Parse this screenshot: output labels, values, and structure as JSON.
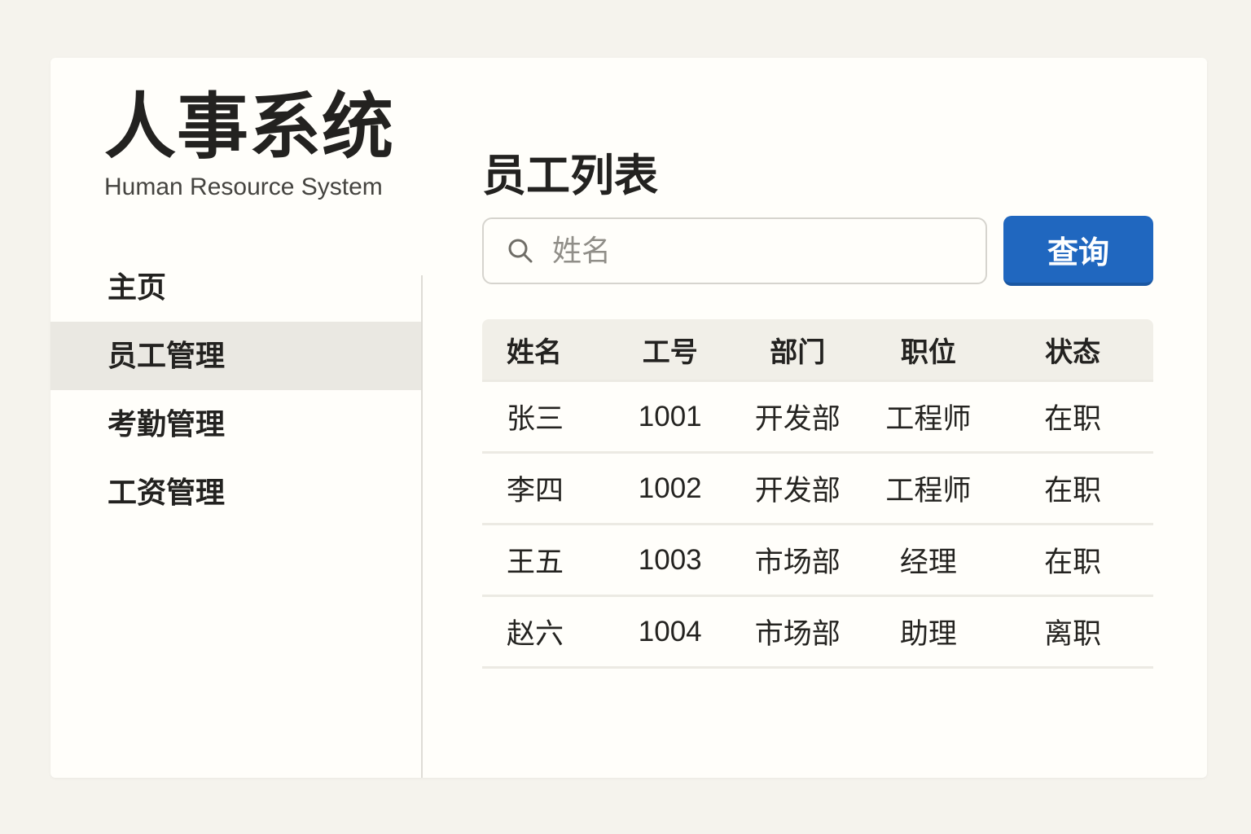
{
  "app": {
    "title": "人事系统",
    "subtitle": "Human Resource System"
  },
  "sidebar": {
    "items": [
      {
        "label": "主页",
        "active": false
      },
      {
        "label": "员工管理",
        "active": true
      },
      {
        "label": "考勤管理",
        "active": false
      },
      {
        "label": "工资管理",
        "active": false
      }
    ]
  },
  "main": {
    "title": "员工列表",
    "search": {
      "placeholder": "姓名",
      "value": "",
      "button_label": "查询",
      "icon": "search-icon"
    },
    "table": {
      "columns": [
        "姓名",
        "工号",
        "部门",
        "职位",
        "状态"
      ],
      "rows": [
        [
          "张三",
          "1001",
          "开发部",
          "工程师",
          "在职"
        ],
        [
          "李四",
          "1002",
          "开发部",
          "工程师",
          "在职"
        ],
        [
          "王五",
          "1003",
          "市场部",
          "经理",
          "在职"
        ],
        [
          "赵六",
          "1004",
          "市场部",
          "助理",
          "离职"
        ]
      ]
    }
  },
  "colors": {
    "page_background": "#f5f3ed",
    "card_background": "#fffefa",
    "accent_blue": "#2067bf",
    "active_item_background": "#eae8e2",
    "table_header_background": "#f1efe8",
    "divider": "#dedcd6",
    "text_primary": "#232220",
    "placeholder_gray": "#908e88"
  }
}
